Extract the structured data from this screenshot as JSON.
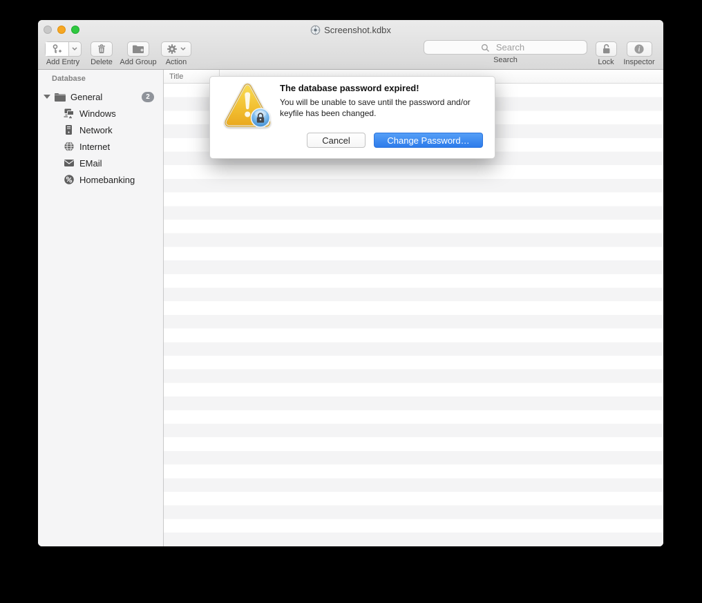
{
  "window": {
    "title": "Screenshot.kdbx"
  },
  "titlebar": {
    "traffic_lights": [
      {
        "name": "close",
        "color": "#c8c8c8"
      },
      {
        "name": "minimize",
        "color": "#f6a723"
      },
      {
        "name": "zoom",
        "color": "#2fc840"
      }
    ]
  },
  "toolbar": {
    "add_entry": {
      "label": "Add Entry",
      "icon": "key-plus-icon"
    },
    "delete": {
      "label": "Delete",
      "icon": "trash-icon"
    },
    "add_group": {
      "label": "Add Group",
      "icon": "folder-plus-icon"
    },
    "action": {
      "label": "Action",
      "icon": "gear-icon"
    },
    "search": {
      "label": "Search",
      "placeholder": "Search",
      "icon": "magnifier-icon"
    },
    "lock": {
      "label": "Lock",
      "icon": "open-padlock-icon"
    },
    "inspector": {
      "label": "Inspector",
      "icon": "info-icon"
    }
  },
  "sidebar": {
    "header": "Database",
    "tree": [
      {
        "label": "General",
        "icon": "folder-icon",
        "badge": "2",
        "expanded": true,
        "children": [
          {
            "label": "Windows",
            "icon": "windows-network-icon"
          },
          {
            "label": "Network",
            "icon": "server-icon"
          },
          {
            "label": "Internet",
            "icon": "globe-icon"
          },
          {
            "label": "EMail",
            "icon": "envelope-icon"
          },
          {
            "label": "Homebanking",
            "icon": "percent-icon"
          }
        ]
      }
    ]
  },
  "table": {
    "columns": [
      {
        "label": "Title"
      }
    ]
  },
  "dialog": {
    "title": "The database password expired!",
    "message": "You will be unable to save until the password and/or keyfile has been changed.",
    "cancel_label": "Cancel",
    "confirm_label": "Change Password…",
    "icon": "warning-triangle-lock-icon"
  },
  "colors": {
    "confirm_button_blue": "#3b87f0",
    "warning_yellow": "#f2bf35",
    "badge_gray": "#8f939a",
    "toolbar_bg": "#e4e4e4",
    "sidebar_bg": "#f5f5f6",
    "row_stripe": "#f4f4f5"
  }
}
